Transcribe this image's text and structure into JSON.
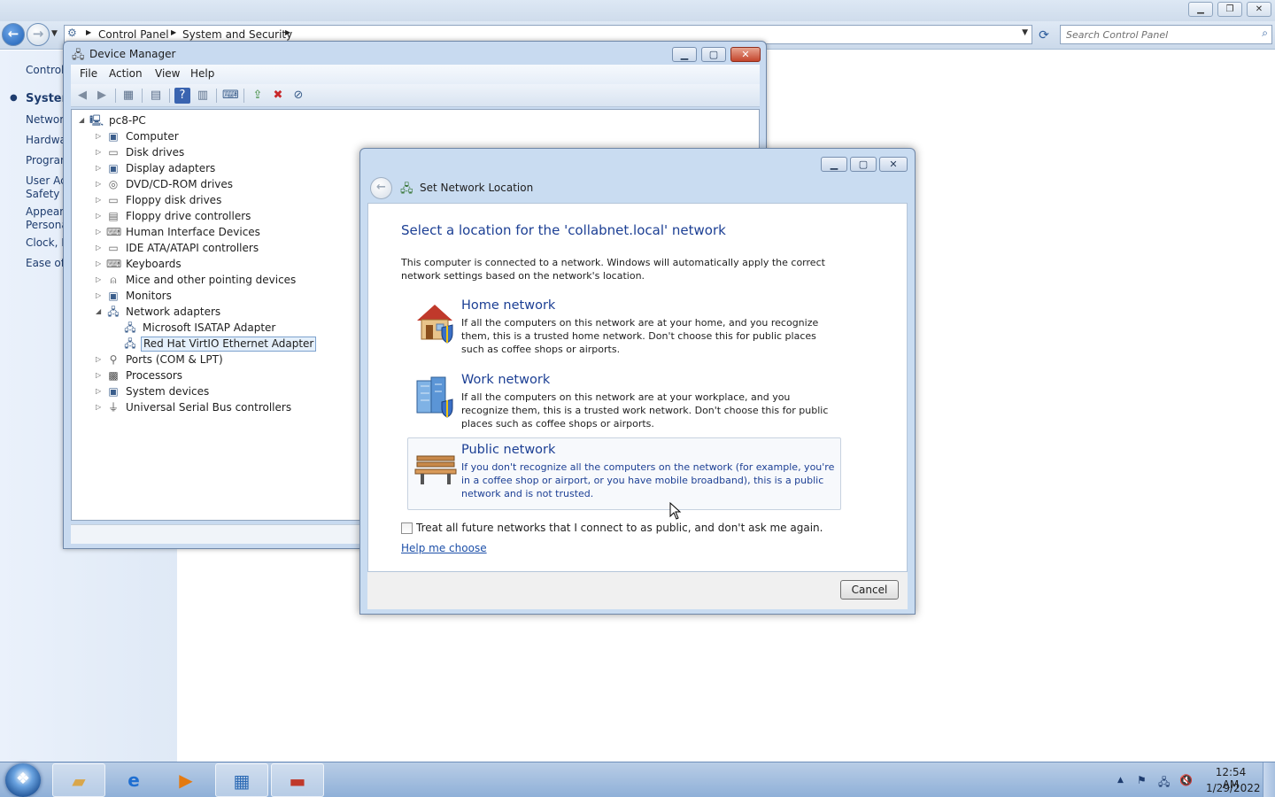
{
  "control_panel": {
    "breadcrumbs": [
      "Control Panel",
      "System and Security"
    ],
    "search_placeholder": "Search Control Panel",
    "sidebar": [
      {
        "label": "Control"
      },
      {
        "label": "System"
      },
      {
        "label": "Networ"
      },
      {
        "label": "Hardwa"
      },
      {
        "label": "Progran"
      },
      {
        "label": "User Ac"
      },
      {
        "label": "Safety"
      },
      {
        "label": "Appeara"
      },
      {
        "label": "Persona"
      },
      {
        "label": "Clock, L"
      },
      {
        "label": "Ease of A"
      }
    ]
  },
  "device_manager": {
    "title": "Device Manager",
    "menu": [
      "File",
      "Action",
      "View",
      "Help"
    ],
    "tree": {
      "root": "pc8-PC",
      "items": [
        "Computer",
        "Disk drives",
        "Display adapters",
        "DVD/CD-ROM drives",
        "Floppy disk drives",
        "Floppy drive controllers",
        "Human Interface Devices",
        "IDE ATA/ATAPI controllers",
        "Keyboards",
        "Mice and other pointing devices",
        "Monitors",
        "Network adapters",
        "Microsoft ISATAP Adapter",
        "Red Hat VirtIO Ethernet Adapter",
        "Ports (COM & LPT)",
        "Processors",
        "System devices",
        "Universal Serial Bus controllers"
      ]
    }
  },
  "set_network_location": {
    "title": "Set Network Location",
    "heading": "Select a location for the 'collabnet.local' network",
    "description": "This computer is connected to a network. Windows will automatically apply the correct network settings based on the network's location.",
    "options": [
      {
        "title": "Home network",
        "text": "If all the computers on this network are at your home, and you recognize them, this is a trusted home network.  Don't choose this for public places such as coffee shops or airports.",
        "icon": "house-icon"
      },
      {
        "title": "Work network",
        "text": "If all the computers on this network are at your workplace, and you recognize them, this is a trusted work network.  Don't choose this for public places such as coffee shops or airports.",
        "icon": "office-building-icon"
      },
      {
        "title": "Public network",
        "text": "If you don't recognize all the computers on the network (for example, you're in a coffee shop or airport, or you have mobile broadband), this is a public network and is not trusted.",
        "icon": "park-bench-icon"
      }
    ],
    "checkbox_label": "Treat all future networks that I connect to as public, and don't ask me again.",
    "help_link": "Help me choose",
    "cancel_label": "Cancel"
  },
  "taskbar": {
    "time": "12:54 AM",
    "date": "1/29/2022"
  }
}
